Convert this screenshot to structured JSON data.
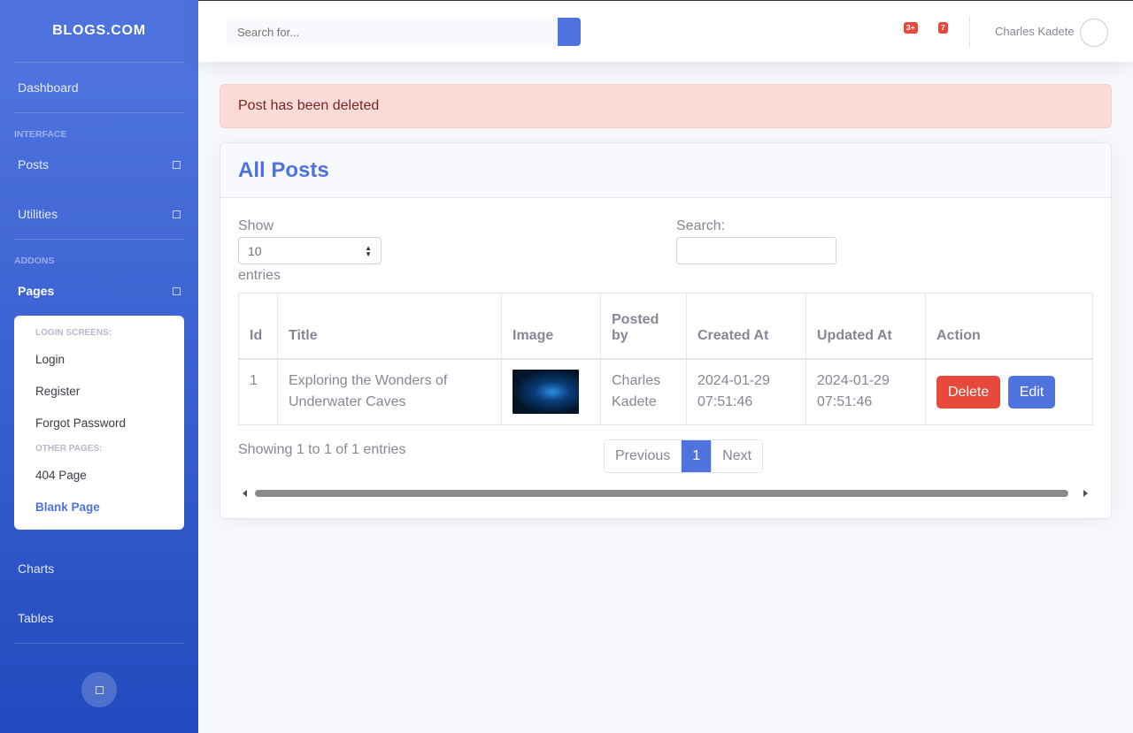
{
  "sidebar": {
    "brand": "BLOGS.COM",
    "dashboard": "Dashboard",
    "heading_interface": "INTERFACE",
    "posts": "Posts",
    "utilities": "Utilities",
    "heading_addons": "ADDONS",
    "pages": "Pages",
    "collapse": {
      "login_header": "LOGIN SCREENS:",
      "login": "Login",
      "register": "Register",
      "forgot": "Forgot Password",
      "other_header": "OTHER PAGES:",
      "page404": "404 Page",
      "blank": "Blank Page"
    },
    "charts": "Charts",
    "tables": "Tables"
  },
  "topbar": {
    "search_placeholder": "Search for...",
    "alerts_badge": "3+",
    "messages_badge": "7",
    "user_name": "Charles Kadete"
  },
  "alert": {
    "message": "Post has been deleted"
  },
  "card": {
    "title": "All Posts",
    "show_label": "Show",
    "page_length": "10",
    "entries_label": "entries",
    "search_label": "Search:",
    "columns": [
      "Id",
      "Title",
      "Image",
      "Posted by",
      "Created At",
      "Updated At",
      "Action"
    ],
    "rows": [
      {
        "id": "1",
        "title": "Exploring the Wonders of Underwater Caves",
        "posted_by": "Charles Kadete",
        "created_at": "2024-01-29 07:51:46",
        "updated_at": "2024-01-29 07:51:46",
        "delete_label": "Delete",
        "edit_label": "Edit"
      }
    ],
    "info": "Showing 1 to 1 of 1 entries",
    "pagination": {
      "previous": "Previous",
      "current": "1",
      "next": "Next"
    }
  },
  "colors": {
    "primary": "#4e73df",
    "danger": "#e74a3b",
    "alert_bg": "#fadbd8"
  }
}
